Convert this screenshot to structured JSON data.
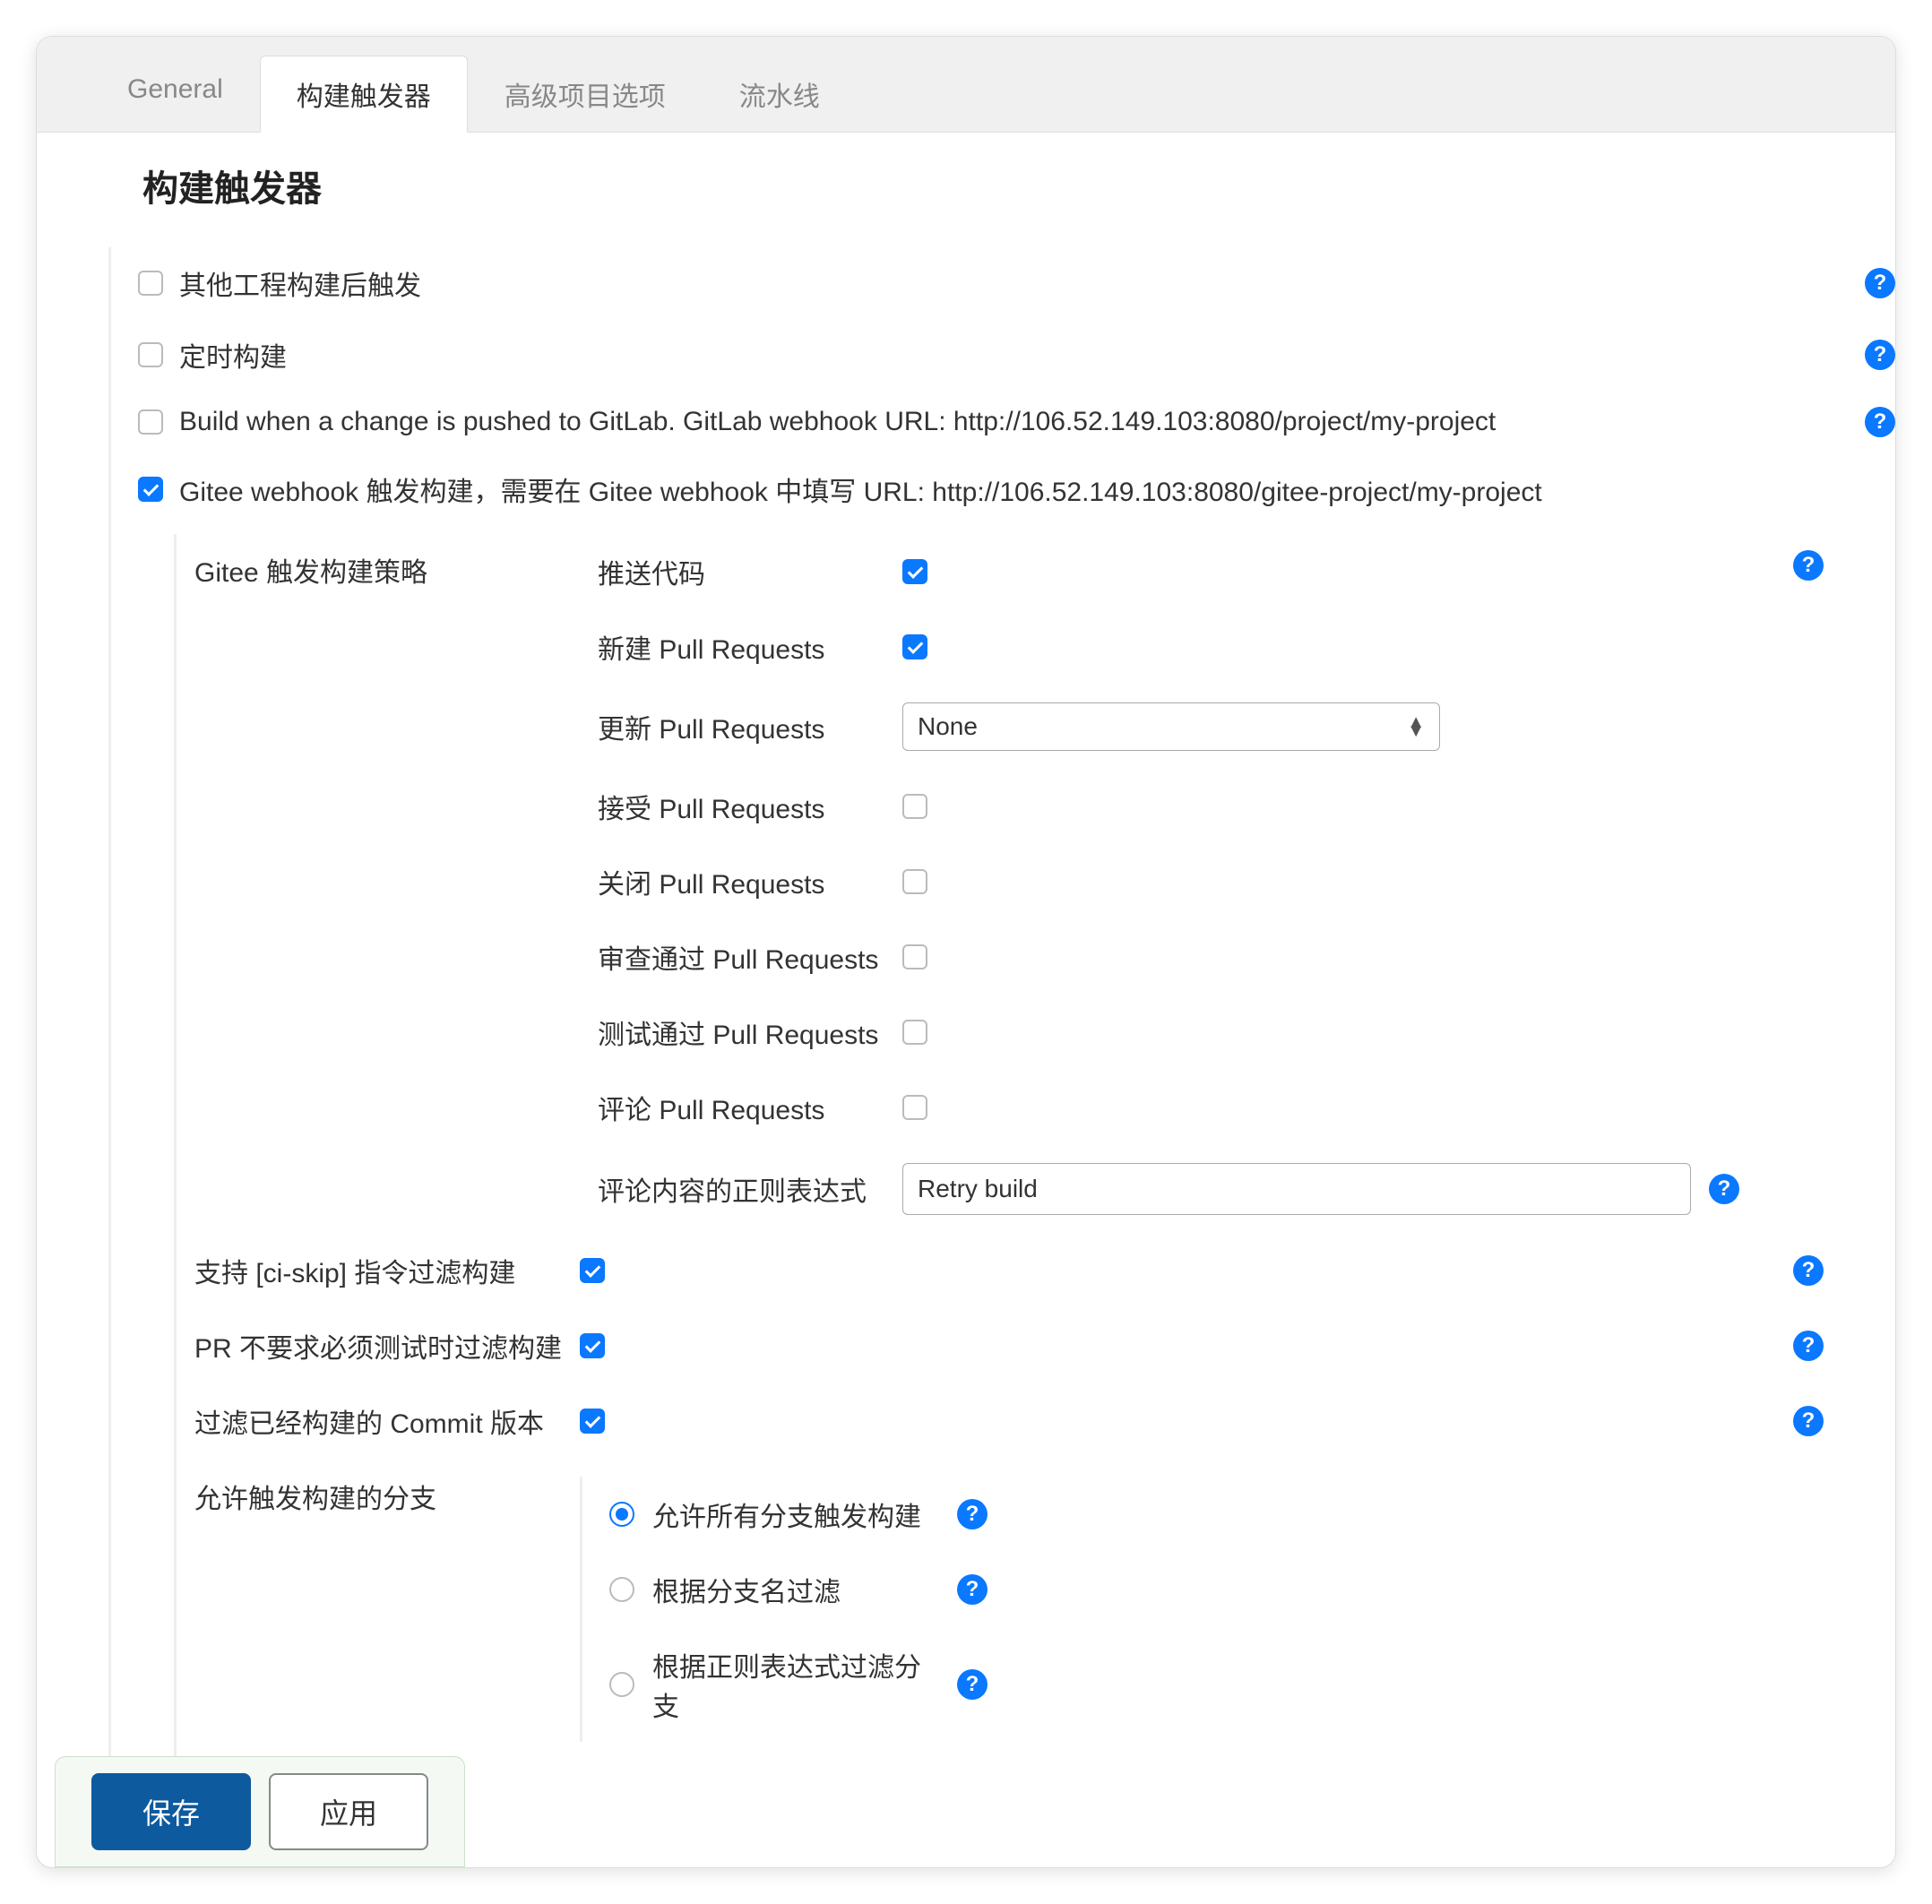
{
  "tabs": {
    "general": "General",
    "triggers": "构建触发器",
    "advanced": "高级项目选项",
    "pipeline": "流水线"
  },
  "section_title": "构建触发器",
  "triggers": {
    "other_project": "其他工程构建后触发",
    "timed": "定时构建",
    "gitlab": "Build when a change is pushed to GitLab. GitLab webhook URL: http://106.52.149.103:8080/project/my-project",
    "gitee": "Gitee webhook 触发构建，需要在 Gitee webhook 中填写 URL: http://106.52.149.103:8080/gitee-project/my-project"
  },
  "strategy": {
    "title": "Gitee 触发构建策略",
    "push": "推送代码",
    "new_pr": "新建 Pull Requests",
    "update_pr": "更新 Pull Requests",
    "update_pr_value": "None",
    "accept_pr": "接受 Pull Requests",
    "close_pr": "关闭 Pull Requests",
    "review_pr": "审查通过 Pull Requests",
    "test_pr": "测试通过 Pull Requests",
    "comment_pr": "评论 Pull Requests",
    "comment_regex": "评论内容的正则表达式",
    "comment_regex_value": "Retry build"
  },
  "options": {
    "ci_skip": "支持 [ci-skip] 指令过滤构建",
    "pr_no_test": "PR 不要求必须测试时过滤构建",
    "filter_built": "过滤已经构建的 Commit 版本",
    "allowed_branches": "允许触发构建的分支"
  },
  "branch": {
    "all": "允许所有分支触发构建",
    "by_name": "根据分支名过滤",
    "by_regex": "根据正则表达式过滤分支"
  },
  "buttons": {
    "save": "保存",
    "apply": "应用"
  }
}
